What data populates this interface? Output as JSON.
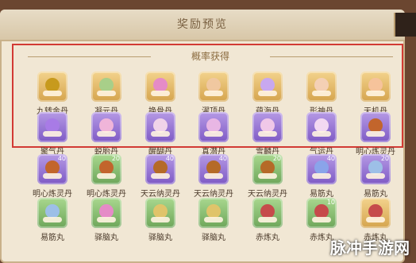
{
  "window": {
    "title": "奖励预览"
  },
  "section": {
    "label": "概率获得"
  },
  "probability_row_1": [
    {
      "name": "九转金丹",
      "icon": "gold-pill-icon",
      "frame": "gold",
      "orb": "#c79a1d"
    },
    {
      "name": "凝元丹",
      "icon": "pill-icon",
      "frame": "gold",
      "orb": "#a8cf89"
    },
    {
      "name": "换骨丹",
      "icon": "pill-icon",
      "frame": "gold",
      "orb": "#e58bc7"
    },
    {
      "name": "濯顶丹",
      "icon": "pill-icon",
      "frame": "gold",
      "orb": "#f0c8a0"
    },
    {
      "name": "蕴海丹",
      "icon": "pill-icon",
      "frame": "gold",
      "orb": "#c8a8ef"
    },
    {
      "name": "形神丹",
      "icon": "pill-icon",
      "frame": "gold",
      "orb": "#f4d0b5"
    },
    {
      "name": "天机丹",
      "icon": "pill-icon",
      "frame": "gold",
      "orb": "#f6c39b"
    }
  ],
  "probability_row_2": [
    {
      "name": "聚气丹",
      "icon": "pill-icon",
      "frame": "purple",
      "orb": "#a87be6"
    },
    {
      "name": "蜕胎丹",
      "icon": "pill-icon",
      "frame": "purple",
      "orb": "#f0b5d9"
    },
    {
      "name": "醒醐丹",
      "icon": "pill-icon",
      "frame": "purple",
      "orb": "#f0d3e9"
    },
    {
      "name": "真潜丹",
      "icon": "pill-icon",
      "frame": "purple",
      "orb": "#e8b6e4"
    },
    {
      "name": "雪麟丹",
      "icon": "pill-icon",
      "frame": "purple",
      "orb": "#f0c8e8"
    },
    {
      "name": "气运丹",
      "icon": "pill-icon",
      "frame": "purple",
      "orb": "#f3d9f2"
    },
    {
      "name": "明心炼灵丹",
      "icon": "gourd-icon",
      "frame": "purple",
      "orb": "#c2652c"
    }
  ],
  "row_3": [
    {
      "name": "明心炼灵丹",
      "count": "40",
      "frame": "purple",
      "orb": "#c2652c"
    },
    {
      "name": "明心炼灵丹",
      "count": "20",
      "frame": "green",
      "orb": "#c2652c"
    },
    {
      "name": "天云纳灵丹",
      "count": "40",
      "frame": "purple",
      "orb": "#b56a28"
    },
    {
      "name": "天云纳灵丹",
      "count": "40",
      "frame": "purple",
      "orb": "#b56a28"
    },
    {
      "name": "天云纳灵丹",
      "count": "20",
      "frame": "green",
      "orb": "#b56a28"
    },
    {
      "name": "易筋丸",
      "count": "40",
      "frame": "purple",
      "orb": "#8aa4ea"
    },
    {
      "name": "易筋丸",
      "count": "20",
      "frame": "purple",
      "orb": "#9dbfe7"
    }
  ],
  "row_4": [
    {
      "name": "易筋丸",
      "count": "",
      "frame": "green",
      "orb": "#9dbfe7"
    },
    {
      "name": "驿脑丸",
      "count": "",
      "frame": "green",
      "orb": "#e58bc7"
    },
    {
      "name": "驿脑丸",
      "count": "",
      "frame": "green",
      "orb": "#e0c46a"
    },
    {
      "name": "驿脑丸",
      "count": "",
      "frame": "green",
      "orb": "#e0c46a"
    },
    {
      "name": "赤炼丸",
      "count": "",
      "frame": "green",
      "orb": "#c64b4b"
    },
    {
      "name": "赤炼丸",
      "count": "10",
      "frame": "green",
      "orb": "#c64b4b"
    },
    {
      "name": "赤炼丸",
      "count": "",
      "frame": "gold",
      "orb": "#c64b4b"
    }
  ],
  "watermark": "脉冲手游网"
}
